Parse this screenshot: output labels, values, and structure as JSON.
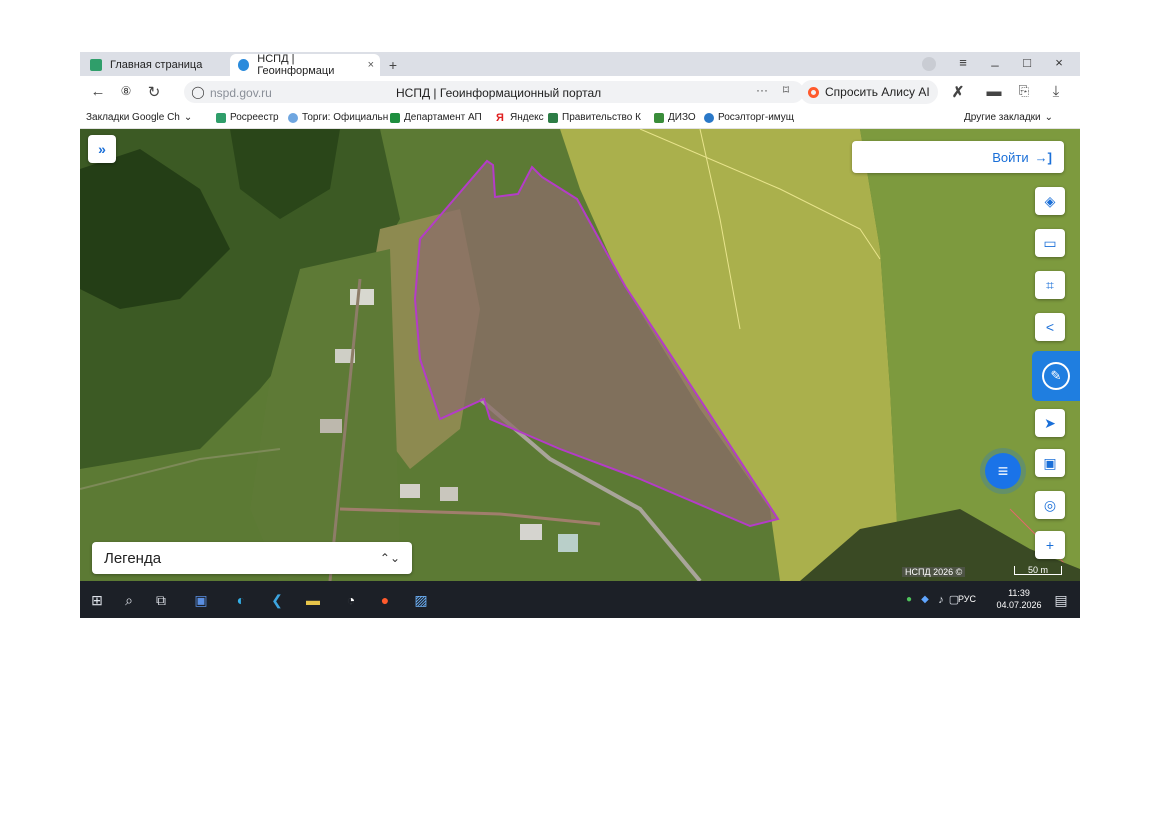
{
  "browser": {
    "tabs": [
      {
        "label": "Главная страница"
      },
      {
        "label": "НСПД | Геоинформаци",
        "close": "×"
      }
    ],
    "new_tab": "+",
    "window_controls": {
      "menu": "≡",
      "minimize": "_",
      "maximize": "□",
      "close": "×"
    },
    "url": "nspd.gov.ru",
    "page_title": "НСПД | Геоинформационный портал",
    "alice_label": "Спросить Алису AI",
    "bookmarks": [
      {
        "label": "Закладки Google Ch",
        "chevron": "⌄"
      },
      {
        "label": "Росреестр"
      },
      {
        "label": "Торги: Официальн"
      },
      {
        "label": "Департамент АП"
      },
      {
        "label": "Яндекс"
      },
      {
        "label": "Правительство К"
      },
      {
        "label": "ДИЗО"
      },
      {
        "label": "Росэлторг-имущ"
      }
    ],
    "other_bookmarks": "Другие закладки"
  },
  "map": {
    "expand_icon": "»",
    "login_label": "Войти",
    "login_icon": "→]",
    "legend_label": "Легенда",
    "legend_chevron": "⌃⌄",
    "attribution": "НСПД 2026 ©",
    "scale_label": "50 m",
    "tools": [
      "layers-icon",
      "ruler-icon",
      "select-area-icon",
      "share-icon",
      "navigate-icon",
      "print-icon",
      "locate-icon",
      "zoom-in-icon"
    ],
    "zoom_in": "+"
  },
  "taskbar": {
    "language": "РУС",
    "time": "11:39",
    "date": "04.07.2026"
  },
  "colors": {
    "accent": "#1a73e8",
    "parcel_outline": "#b43cc8",
    "taskbar": "#1c2027"
  }
}
